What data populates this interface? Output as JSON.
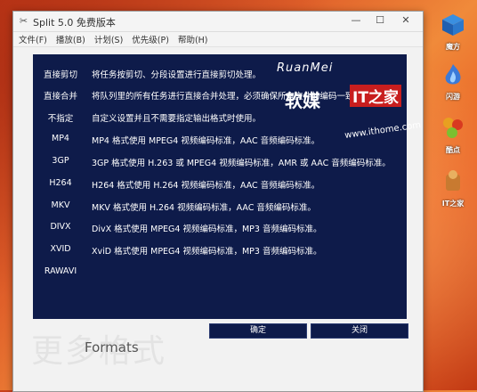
{
  "window": {
    "title": "Split 5.0 免费版本",
    "minimize": "—",
    "maximize": "☐",
    "close": "✕"
  },
  "menu": [
    "文件(F)",
    "播放(B)",
    "计划(S)",
    "优先级(P)",
    "帮助(H)"
  ],
  "formats": [
    {
      "name": "直接剪切",
      "desc": "将任务按剪切、分段设置进行直接剪切处理。"
    },
    {
      "name": "直接合并",
      "desc": "将队列里的所有任务进行直接合并处理，必须确保所有文件的编码一致。"
    },
    {
      "name": "不指定",
      "desc": "自定义设置并且不需要指定输出格式时使用。"
    },
    {
      "name": "MP4",
      "desc": "MP4 格式使用 MPEG4 视频编码标准，AAC 音频编码标准。"
    },
    {
      "name": "3GP",
      "desc": "3GP 格式使用 H.263 或 MPEG4 视频编码标准，AMR 或 AAC 音频编码标准。"
    },
    {
      "name": "H264",
      "desc": "H264 格式使用 H.264 视频编码标准，AAC 音频编码标准。"
    },
    {
      "name": "MKV",
      "desc": "MKV 格式使用 H.264 视频编码标准，AAC 音频编码标准。"
    },
    {
      "name": "DIVX",
      "desc": "DivX 格式使用 MPEG4 视频编码标准，MP3 音频编码标准。"
    },
    {
      "name": "XVID",
      "desc": "XviD 格式使用 MPEG4 视频编码标准，MP3 音频编码标准。"
    },
    {
      "name": "RAWAVI",
      "desc": ""
    }
  ],
  "buttons": {
    "ok": "确定",
    "close": "关闭"
  },
  "footer": {
    "watermark": "更多格式",
    "label": "Formats"
  },
  "brand": {
    "ruanmei": "RuanMei",
    "cn": "软媒",
    "it": "IT之家",
    "url": "www.ithome.com"
  },
  "desktop_icons": [
    {
      "label": "魔方",
      "icon": "cube-icon"
    },
    {
      "label": "闪游",
      "icon": "flame-icon"
    },
    {
      "label": "酷点",
      "icon": "dots-icon"
    },
    {
      "label": "IT之家",
      "icon": "ithome-icon"
    }
  ],
  "colors": {
    "panel": "#0e1b4a",
    "desktop": "#e0602a"
  }
}
